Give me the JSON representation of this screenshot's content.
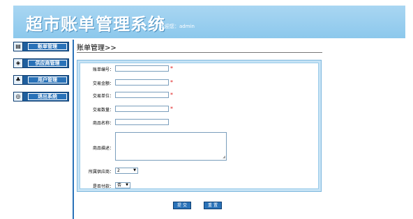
{
  "header": {
    "title": "超市账单管理系统",
    "welcome": "欢迎您：admin"
  },
  "sidebar": {
    "items": [
      {
        "label": "账单管理",
        "icon": "bill-icon"
      },
      {
        "label": "供应商管理",
        "icon": "supplier-icon"
      },
      {
        "label": "用户管理",
        "icon": "users-icon"
      },
      {
        "label": "退出系统",
        "icon": "exit-icon"
      }
    ]
  },
  "breadcrumb": "账单管理>>",
  "form": {
    "bill_no_label": "账单编号：",
    "amount_label": "交易金额：",
    "unit_label": "交易单位：",
    "quantity_label": "交易数量：",
    "product_name_label": "商品名称：",
    "product_desc_label": "商品描述：",
    "supplier_label": "所属供应商：",
    "supplier_value": "2",
    "paid_label": "是否付款：",
    "paid_value": "否",
    "required_mark": "*"
  },
  "buttons": {
    "submit": "提 交",
    "reset": "重 置"
  },
  "colors": {
    "header_bg": "#a9d6f2",
    "nav_bg": "#2a72b8",
    "required": "#e02020"
  }
}
